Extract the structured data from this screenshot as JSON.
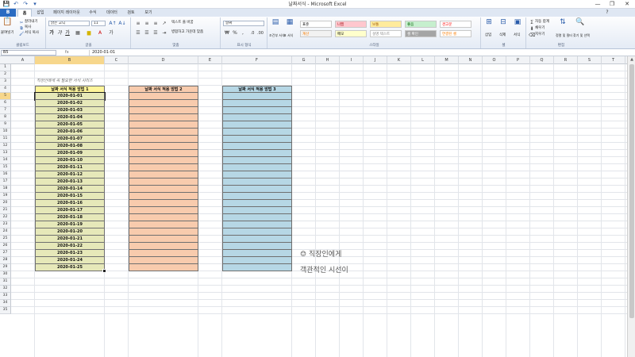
{
  "window": {
    "title": "날짜서식 - Microsoft Excel",
    "controls": [
      "—",
      "❐",
      "✕"
    ]
  },
  "quick_access": [
    "💾",
    "↶",
    "↷",
    "▾"
  ],
  "tabs": [
    {
      "label": "홈",
      "active": true
    },
    {
      "label": "삽입"
    },
    {
      "label": "페이지 레이아웃"
    },
    {
      "label": "수식"
    },
    {
      "label": "데이터"
    },
    {
      "label": "검토"
    },
    {
      "label": "보기"
    }
  ],
  "file_tab": "B",
  "ribbon": {
    "clipboard": {
      "label": "클립보드",
      "paste": "붙여넣기",
      "cut": "잘라내기",
      "copy": "복사",
      "format_painter": "서식 복사"
    },
    "font": {
      "label": "글꼴",
      "font_name": "맑은 고딕",
      "font_size": "11",
      "bold": "가",
      "italic": "가",
      "underline": "가"
    },
    "alignment": {
      "label": "맞춤",
      "wrap_text": "텍스트 줄 바꿈",
      "merge_center": "병합하고 가운데 맞춤"
    },
    "number": {
      "label": "표시 형식",
      "format": "날짜",
      "currency": "₩",
      "percent": "%",
      "comma": ","
    },
    "styles": {
      "label": "스타일",
      "conditional": "조건부 서식",
      "table": "표 서식",
      "cells": [
        {
          "label": "표준",
          "bg": "#ffffff",
          "color": "#000000"
        },
        {
          "label": "나쁨",
          "bg": "#ffc7ce",
          "color": "#9c0006"
        },
        {
          "label": "보통",
          "bg": "#ffeb9c",
          "color": "#9c5700"
        },
        {
          "label": "좋음",
          "bg": "#c6efce",
          "color": "#006100"
        },
        {
          "label": "경고문",
          "bg": "#ffffff",
          "color": "#ff0000"
        },
        {
          "label": "계산",
          "bg": "#f2f2f2",
          "color": "#fa7d00"
        },
        {
          "label": "메모",
          "bg": "#ffffcc",
          "color": "#000000"
        },
        {
          "label": "설명 텍스트",
          "bg": "#ffffff",
          "color": "#7f7f7f"
        },
        {
          "label": "셀 확인",
          "bg": "#a5a5a5",
          "color": "#ffffff"
        },
        {
          "label": "연결된 셀",
          "bg": "#ffffff",
          "color": "#fa7d00"
        }
      ]
    },
    "cells": {
      "label": "셀",
      "insert": "삽입",
      "delete": "삭제",
      "format": "서식"
    },
    "editing": {
      "label": "편집",
      "autosum": "자동 합계",
      "fill": "채우기",
      "clear": "지우기",
      "sort_filter": "정렬 및 필터",
      "find_select": "찾기 및 선택"
    }
  },
  "formula_bar": {
    "name_box": "B5",
    "fx": "fx",
    "value": "2020-01-01"
  },
  "columns": [
    "A",
    "B",
    "C",
    "D",
    "E",
    "F",
    "G",
    "H",
    "I",
    "J",
    "K",
    "L",
    "M",
    "N",
    "O",
    "P",
    "Q",
    "R",
    "S",
    "T"
  ],
  "rows": [
    "1",
    "2",
    "3",
    "4",
    "5",
    "6",
    "7",
    "8",
    "9",
    "10",
    "11",
    "12",
    "13",
    "14",
    "15",
    "16",
    "17",
    "18",
    "19",
    "20",
    "21",
    "22",
    "23",
    "24",
    "25",
    "26",
    "27",
    "28",
    "29",
    "30",
    "31",
    "32",
    "33",
    "34",
    "35"
  ],
  "selected": {
    "column": "B",
    "row": "5"
  },
  "sheet": {
    "note": "직장인에게 꼭 필요한 서식 시리즈",
    "headers": {
      "col_b": "날짜 서식 적용 방법 1",
      "col_d": "날짜 서식 적용 방법 2",
      "col_f": "날짜 서식 적용 방법 3"
    },
    "dates": [
      "2020-01-01",
      "2020-01-02",
      "2020-01-03",
      "2020-01-04",
      "2020-01-05",
      "2020-01-06",
      "2020-01-07",
      "2020-01-08",
      "2020-01-09",
      "2020-01-10",
      "2020-01-11",
      "2020-01-12",
      "2020-01-13",
      "2020-01-14",
      "2020-01-15",
      "2020-01-16",
      "2020-01-17",
      "2020-01-18",
      "2020-01-19",
      "2020-01-20",
      "2020-01-21",
      "2020-01-22",
      "2020-01-23",
      "2020-01-24",
      "2020-01-25"
    ],
    "watermark_line1": "직장인에게",
    "watermark_line2": "객관적인 시선이"
  },
  "colors": {
    "date_fill": "#e6e8b9",
    "header_fill": "#fff59a",
    "orange_fill": "#f8cbad",
    "blue_fill": "#b6d7e5",
    "selection": "#f7d78c",
    "file_tab": "#2a6bc2"
  }
}
